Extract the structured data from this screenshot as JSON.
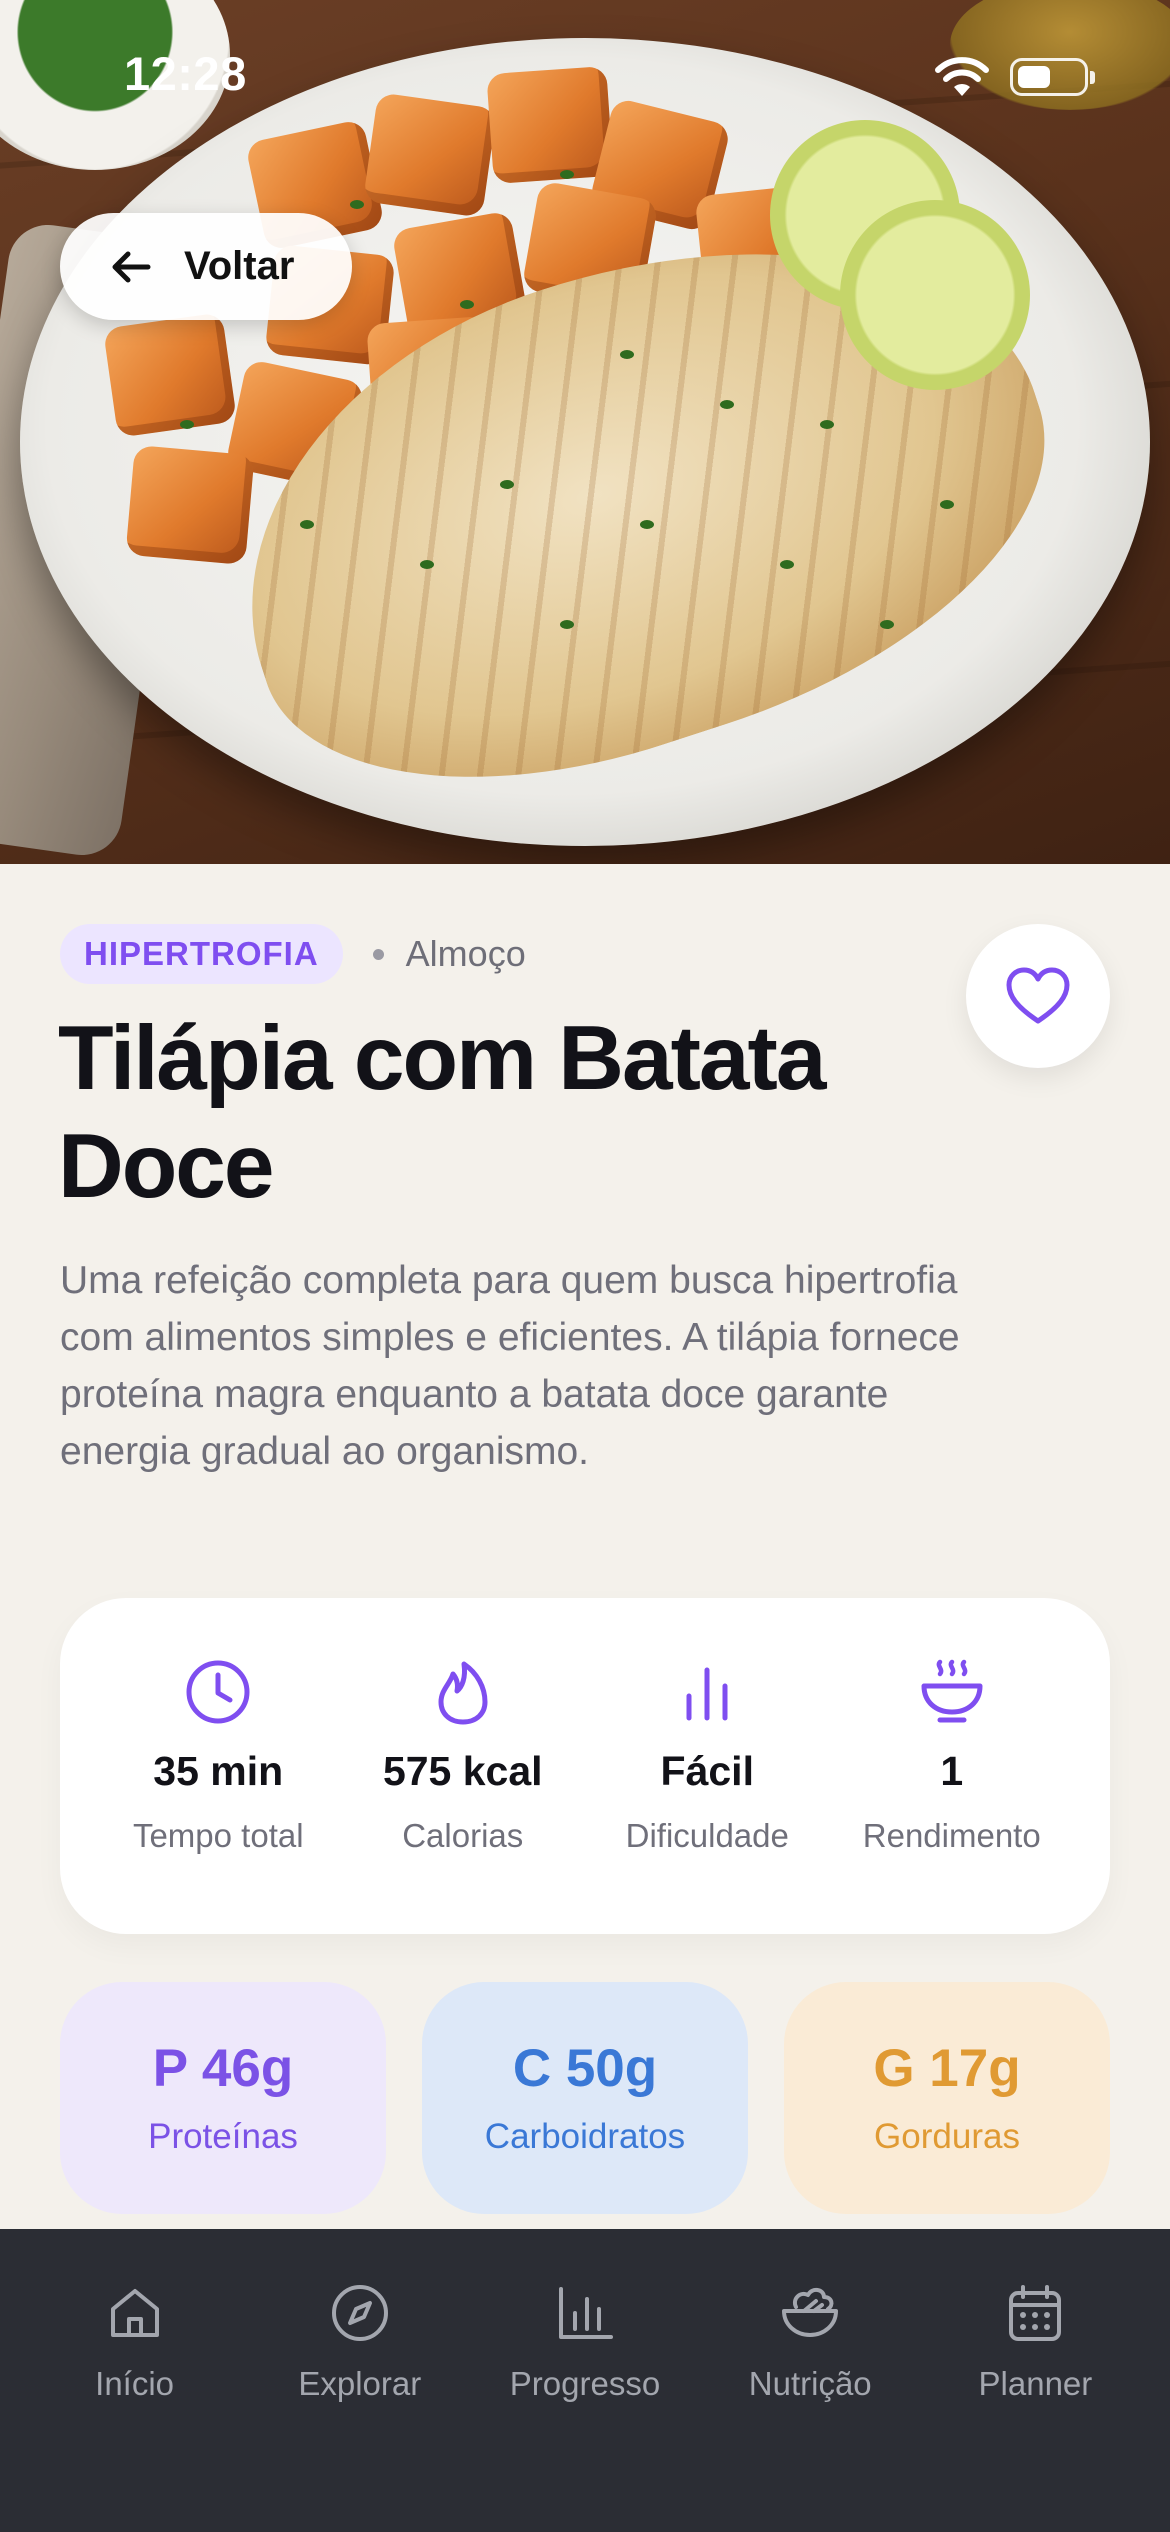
{
  "status_bar": {
    "time": "12:28"
  },
  "header": {
    "back_label": "Voltar"
  },
  "recipe": {
    "category": "HIPERTROFIA",
    "meal_type": "Almoço",
    "title": "Tilápia com Batata Doce",
    "description": "Uma refeição completa para quem busca hipertrofia com alimentos simples e eficientes. A tilápia fornece proteína magra enquanto a batata doce garante energia gradual ao organismo.",
    "favorited": false
  },
  "stats": [
    {
      "icon": "clock-icon",
      "value": "35 min",
      "label": "Tempo total"
    },
    {
      "icon": "flame-icon",
      "value": "575 kcal",
      "label": "Calorias"
    },
    {
      "icon": "difficulty-bars-icon",
      "value": "Fácil",
      "label": "Dificuldade"
    },
    {
      "icon": "steaming-bowl-icon",
      "value": "1",
      "label": "Rendimento"
    }
  ],
  "macros": [
    {
      "value": "P 46g",
      "label": "Proteínas",
      "color": "#7b52e6"
    },
    {
      "value": "C 50g",
      "label": "Carboidratos",
      "color": "#3a78d6"
    },
    {
      "value": "G 17g",
      "label": "Gorduras",
      "color": "#e09a33"
    }
  ],
  "bottom_nav": [
    {
      "icon": "home-icon",
      "label": "Início"
    },
    {
      "icon": "compass-icon",
      "label": "Explorar"
    },
    {
      "icon": "bar-chart-icon",
      "label": "Progresso"
    },
    {
      "icon": "salad-bowl-icon",
      "label": "Nutrição"
    },
    {
      "icon": "calendar-icon",
      "label": "Planner"
    }
  ],
  "colors": {
    "accent": "#7f4ef0",
    "background": "#f4f1eb",
    "nav_background": "#2b2d34"
  }
}
